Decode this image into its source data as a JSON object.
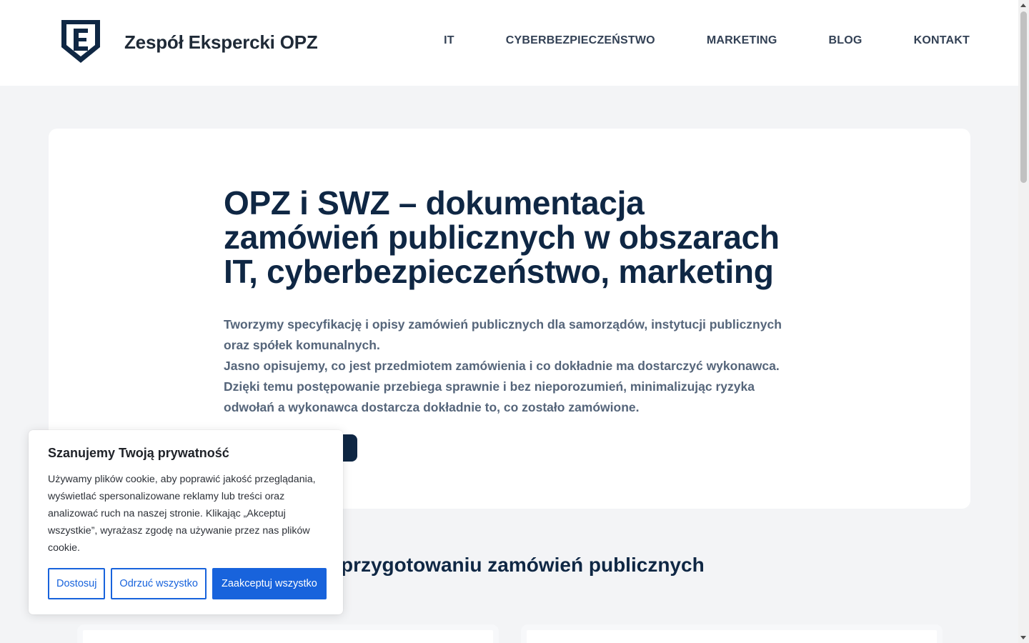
{
  "header": {
    "brand": "Zespół Ekspercki OPZ",
    "logo_letter": "E",
    "nav": [
      {
        "label": "IT"
      },
      {
        "label": "CYBERBEZPIECZEŃSTWO"
      },
      {
        "label": "MARKETING"
      },
      {
        "label": "BLOG"
      },
      {
        "label": "KONTAKT"
      }
    ]
  },
  "hero": {
    "title": "OPZ i SWZ – dokumentacja zamówień publicznych w obszarach IT, cyberbezpieczeństwo, marketing",
    "paragraph1": "Tworzymy specyfikację i opisy zamówień publicznych dla samorządów, instytucji publicznych oraz spółek komunalnych.",
    "paragraph2": "Jasno opisujemy, co jest przedmiotem zamówienia i co dokładnie ma dostarczyć wykonawca. Dzięki temu postępowanie przebiega sprawnie i bez nieporozumień, minimalizując ryzyka odwołań a wykonawca dostarcza dokładnie to, co zostało zamówione."
  },
  "section": {
    "title_partial": "alizacje w przygotowaniu zamówień publicznych"
  },
  "cookie": {
    "title": "Szanujemy Twoją prywatność",
    "text": "Używamy plików cookie, aby poprawić jakość przeglądania, wyświetlać spersonalizowane reklamy lub treści oraz analizować ruch na naszej stronie. Klikając „Akceptuj wszystkie”, wyrażasz zgodę na używanie przez nas plików cookie.",
    "customize_label": "Dostosuj",
    "reject_label": "Odrzuć wszystko",
    "accept_label": "Zaakceptuj wszystko"
  },
  "colors": {
    "navy": "#0f2744",
    "cookie_blue": "#1863dc",
    "page_bg": "#f3f4f6"
  }
}
